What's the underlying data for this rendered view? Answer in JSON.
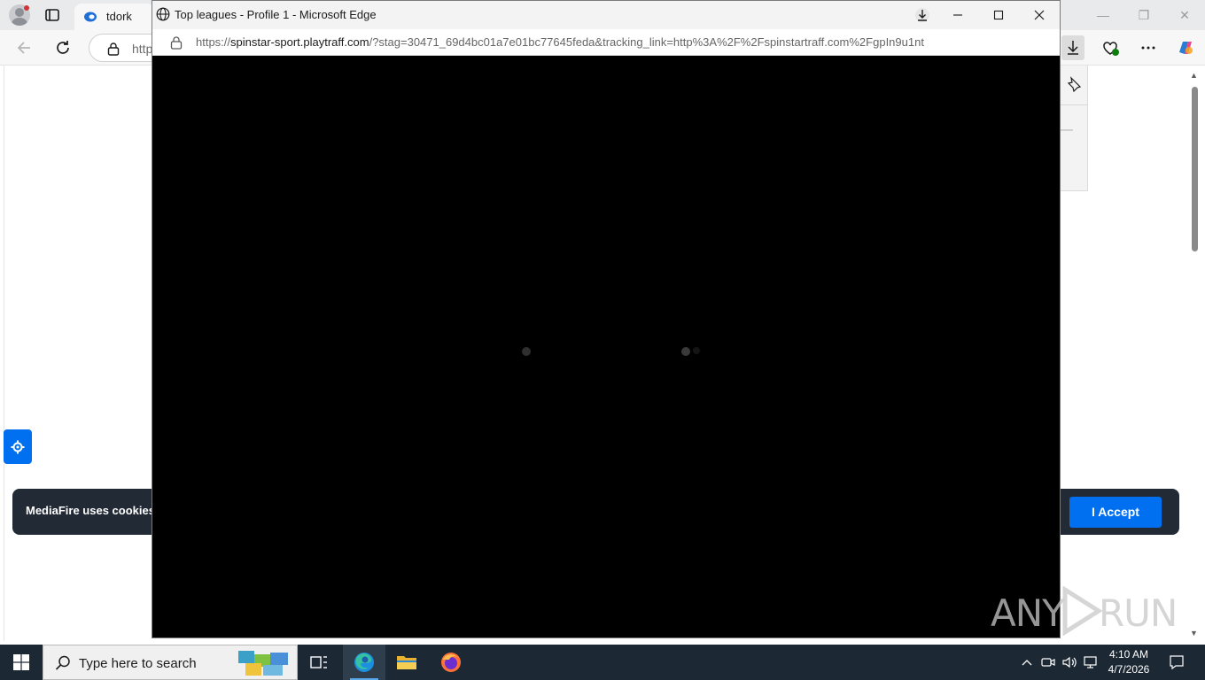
{
  "background_browser": {
    "tab": {
      "title": "tdork"
    },
    "address_partial": "http",
    "cookie_banner": {
      "text": "MediaFire uses cookies t",
      "accept_label": "I Accept"
    }
  },
  "popup": {
    "window_title": "Top leagues - Profile 1 - Microsoft Edge",
    "url_prefix": "https://",
    "url_host": "spinstar-sport.playtraff.com",
    "url_rest": "/?stag=30471_69d4bc01a7e01bc77645feda&tracking_link=http%3A%2F%2Fspinstartraff.com%2FgpIn9u1nt"
  },
  "taskbar": {
    "search_placeholder": "Type here to search",
    "time": "4:10 AM",
    "date": "4/7/2026"
  },
  "watermark": {
    "left": "ANY",
    "right": "RUN"
  },
  "colors": {
    "accent_blue": "#0070f0",
    "banner_bg": "#222a36",
    "taskbar_bg": "#1c2833",
    "popup_content_bg": "#000000"
  },
  "icons": {
    "tabbar": [
      "avatar-icon",
      "tab-actions-icon",
      "tab-favicon-icon"
    ],
    "toolbar": [
      "back-icon",
      "refresh-icon",
      "lock-icon",
      "downloads-icon",
      "extensions-icon",
      "more-icon",
      "copilot-icon"
    ],
    "popup": [
      "globe-icon",
      "download-icon",
      "minimize-icon",
      "maximize-icon",
      "close-icon"
    ],
    "taskbar": [
      "windows-start-icon",
      "search-icon",
      "task-view-icon",
      "edge-icon",
      "file-explorer-icon",
      "firefox-icon",
      "chevron-up-icon",
      "meet-now-icon",
      "volume-icon",
      "network-icon",
      "notification-icon"
    ]
  }
}
